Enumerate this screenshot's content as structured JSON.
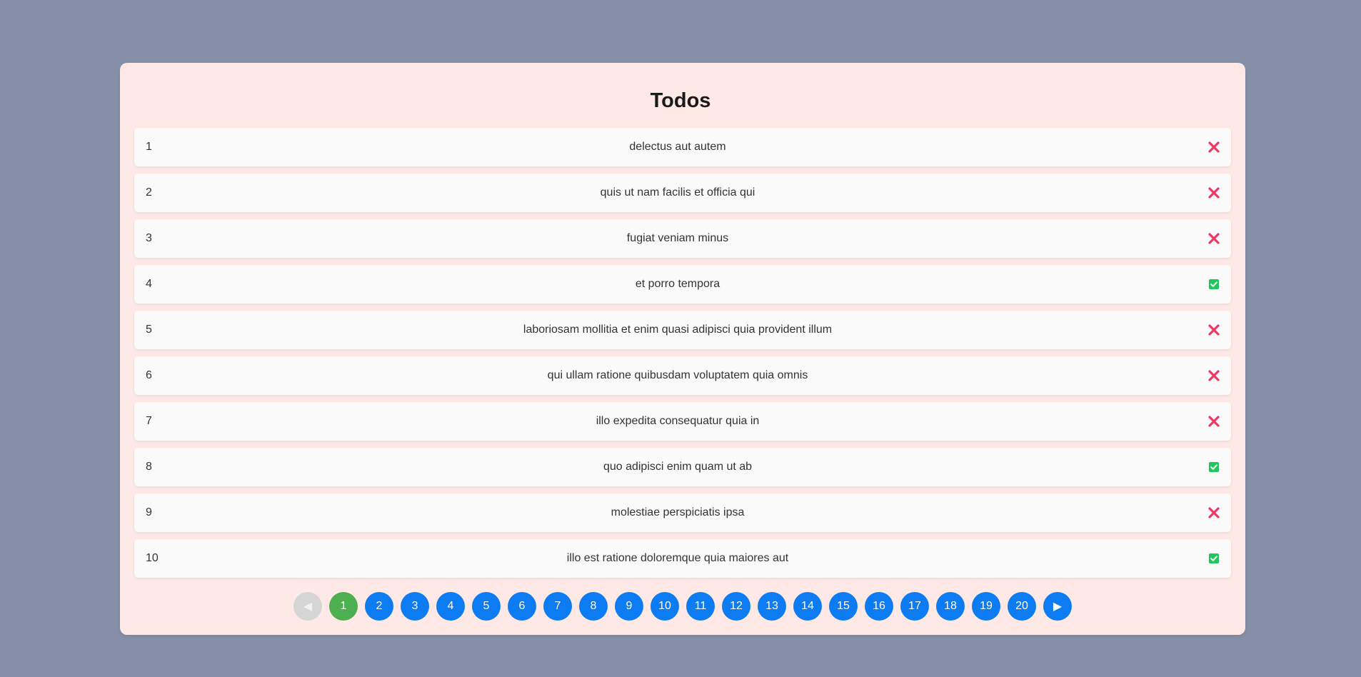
{
  "title": "Todos",
  "colors": {
    "background": "#8590a8",
    "card": "#ffe9e7",
    "incomplete": "#ee3765",
    "complete": "#22c55e",
    "page_button": "#0d7cf2",
    "active_page": "#4caf50",
    "disabled_button": "#d5d5d5"
  },
  "todos": [
    {
      "id": "1",
      "title": "delectus aut autem",
      "completed": false
    },
    {
      "id": "2",
      "title": "quis ut nam facilis et officia qui",
      "completed": false
    },
    {
      "id": "3",
      "title": "fugiat veniam minus",
      "completed": false
    },
    {
      "id": "4",
      "title": "et porro tempora",
      "completed": true
    },
    {
      "id": "5",
      "title": "laboriosam mollitia et enim quasi adipisci quia provident illum",
      "completed": false
    },
    {
      "id": "6",
      "title": "qui ullam ratione quibusdam voluptatem quia omnis",
      "completed": false
    },
    {
      "id": "7",
      "title": "illo expedita consequatur quia in",
      "completed": false
    },
    {
      "id": "8",
      "title": "quo adipisci enim quam ut ab",
      "completed": true
    },
    {
      "id": "9",
      "title": "molestiae perspiciatis ipsa",
      "completed": false
    },
    {
      "id": "10",
      "title": "illo est ratione doloremque quia maiores aut",
      "completed": true
    }
  ],
  "pagination": {
    "prev_label": "◀",
    "next_label": "▶",
    "prev_disabled": true,
    "current_page": "1",
    "pages": [
      "1",
      "2",
      "3",
      "4",
      "5",
      "6",
      "7",
      "8",
      "9",
      "10",
      "11",
      "12",
      "13",
      "14",
      "15",
      "16",
      "17",
      "18",
      "19",
      "20"
    ]
  }
}
